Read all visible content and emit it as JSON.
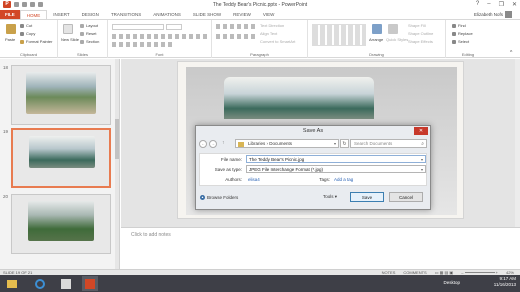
{
  "window": {
    "title": "The Teddy Bear's Picnic.pptx - PowerPoint",
    "controls": [
      "?",
      "–",
      "❐",
      "✕"
    ]
  },
  "ribbon_tabs": [
    "FILE",
    "HOME",
    "INSERT",
    "DESIGN",
    "TRANSITIONS",
    "ANIMATIONS",
    "SLIDE SHOW",
    "REVIEW",
    "VIEW"
  ],
  "active_tab": "HOME",
  "user": {
    "name": "Elizabeth Nofs"
  },
  "ribbon": {
    "clipboard": {
      "label": "Clipboard",
      "paste": "Paste",
      "cut": "Cut",
      "copy": "Copy",
      "format_painter": "Format Painter"
    },
    "slides": {
      "label": "Slides",
      "new_slide": "New Slide",
      "layout": "Layout",
      "reset": "Reset",
      "section": "Section"
    },
    "font": {
      "label": "Font"
    },
    "paragraph": {
      "label": "Paragraph",
      "text_direction": "Text Direction",
      "align_text": "Align Text",
      "convert_smartart": "Convert to SmartArt"
    },
    "drawing": {
      "label": "Drawing",
      "arrange": "Arrange",
      "quick_styles": "Quick Styles",
      "shape_fill": "Shape Fill",
      "shape_outline": "Shape Outline",
      "shape_effects": "Shape Effects"
    },
    "editing": {
      "label": "Editing",
      "find": "Find",
      "replace": "Replace",
      "select": "Select"
    }
  },
  "thumbnails": [
    {
      "number": "18",
      "selected": false
    },
    {
      "number": "19",
      "selected": true
    },
    {
      "number": "20",
      "selected": false
    }
  ],
  "notes_placeholder": "Click to add notes",
  "status": {
    "slide_info": "SLIDE 19 OF 21",
    "notes": "NOTES",
    "comments": "COMMENTS",
    "zoom": "42%"
  },
  "taskbar": {
    "desktop": "Desktop",
    "time": "9:17 AM",
    "date": "11/16/2013"
  },
  "dialog": {
    "title": "Save As",
    "breadcrumb": "Libraries › Documents",
    "search_placeholder": "Search Documents",
    "file_name_label": "File name:",
    "file_name_value": "The Teddy Bear's Picnic.jpg",
    "save_type_label": "Save as type:",
    "save_type_value": "JPEG File Interchange Format (*.jpg)",
    "authors_label": "Authors:",
    "authors_value": "elisa4",
    "tags_label": "Tags:",
    "tags_value": "Add a tag",
    "browse_folders": "Browse Folders",
    "tools": "Tools",
    "save": "Save",
    "cancel": "Cancel"
  },
  "colors": {
    "accent": "#d24726",
    "selection": "#e87b50",
    "taskbar": "#3e3f47"
  }
}
